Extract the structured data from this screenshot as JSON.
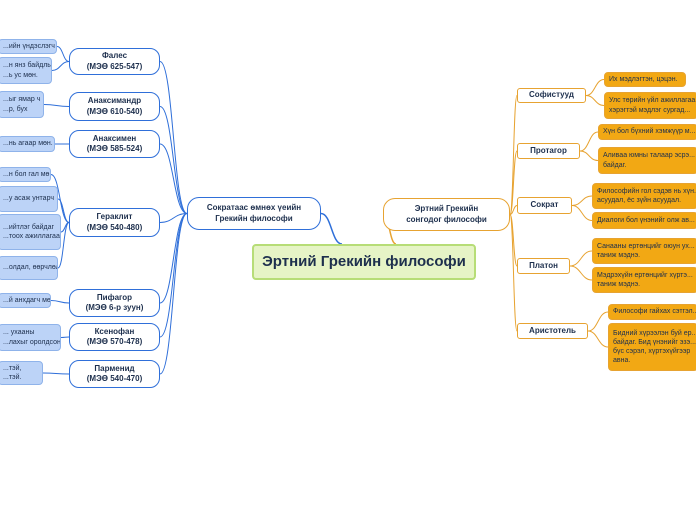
{
  "root": {
    "title": "Эртний Грекийн философи"
  },
  "left_branch": {
    "title": "Сократаас өмнөх үеийн\nГрекийн философи",
    "philosophers": [
      {
        "name": "Фалес\n(МЭӨ 625-547)",
        "notes": [
          "...ийн үндэслэгч",
          "...н янз байдлын\n...ь ус мөн."
        ]
      },
      {
        "name": "Анаксимандр\n(МЭӨ 610-540)",
        "notes": [
          "...ыг ямар ч\n...р, бух"
        ]
      },
      {
        "name": "Анаксимен\n(МЭӨ 585-524)",
        "notes": [
          "...нь агаар мөн."
        ]
      },
      {
        "name": "Гераклит\n(МЭӨ 540-480)",
        "notes": [
          "...н бол гал мөн.",
          "...у асаж унтарч",
          "...ийтлэг байдаг\n...тоох ажиллагаа",
          "...олдал, өөрчлөлт"
        ]
      },
      {
        "name": "Пифагор\n(МЭӨ 6-р зуун)",
        "notes": [
          "...й анхдагч мөн."
        ]
      },
      {
        "name": "Ксенофан\n(МЭӨ 570-478)",
        "notes": [
          "... ухааны\n...лахыг оролдсон."
        ]
      },
      {
        "name": "Парменид\n(МЭӨ 540-470)",
        "notes": [
          "...тэй,\n...тэй."
        ]
      }
    ]
  },
  "right_branch": {
    "title": "Эртний Грекийн\nсонгодог философи",
    "philosophers": [
      {
        "name": "Софистууд",
        "notes": [
          "Их мэдлэгтэн, цэцэн.",
          "Улс төрийн үйл ажиллагаа...\nхэрэгтэй мэдлэг сургад..."
        ]
      },
      {
        "name": "Протагор",
        "notes": [
          "Хүн бол бүхний хэмжүүр м...",
          "Аливаа юмны талаар эсрэ...\nбайдаг."
        ]
      },
      {
        "name": "Сократ",
        "notes": [
          "Философийн гол сэдэв нь хүн...\nасуудал, ёс зүйн асуудал.",
          "Диалоги бол үнэнийг олж ав..."
        ]
      },
      {
        "name": "Платон",
        "notes": [
          "Санааны ертөнцийг оюун ух...\nтаниж мэднэ.",
          "Мэдрэхүйн ертөнцийг хүртэ...\nтаниж мэднэ."
        ]
      },
      {
        "name": "Аристотель",
        "notes": [
          "Философи гайхах сэтгэл...",
          "Бидний хүрээлэн буй ер...\nбайдаг. Бид үнэнийг эзэ...\nбүс сэрэл, хүртэхүйгээр\nавна."
        ]
      }
    ]
  },
  "colors": {
    "left": "#2f6fd9",
    "right": "#e7a331",
    "root_fill": "#e6f4c6",
    "root_border": "#b7dd77"
  }
}
